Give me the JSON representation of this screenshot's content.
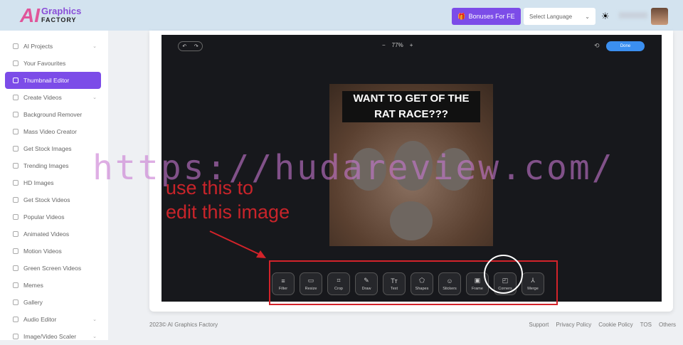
{
  "header": {
    "logo_ai": "AI",
    "logo_graphics": "Graphics",
    "logo_factory": "FACTORY",
    "bonus_label": "Bonuses For FE",
    "language_placeholder": "Select Language"
  },
  "sidebar": {
    "items": [
      {
        "label": "AI Projects",
        "chevron": true
      },
      {
        "label": "Your Favourites"
      },
      {
        "label": "Thumbnail Editor",
        "active": true
      },
      {
        "label": "Create Videos",
        "chevron": true
      },
      {
        "label": "Background Remover"
      },
      {
        "label": "Mass Video Creator"
      },
      {
        "label": "Get Stock Images"
      },
      {
        "label": "Trending Images"
      },
      {
        "label": "HD Images"
      },
      {
        "label": "Get Stock Videos"
      },
      {
        "label": "Popular Videos"
      },
      {
        "label": "Animated Videos"
      },
      {
        "label": "Motion Videos"
      },
      {
        "label": "Green Screen Videos"
      },
      {
        "label": "Memes"
      },
      {
        "label": "Gallery"
      },
      {
        "label": "Audio Editor",
        "chevron": true
      },
      {
        "label": "Image/Video Scaler",
        "chevron": true
      }
    ]
  },
  "editor": {
    "zoom": "77%",
    "done_label": "Done",
    "image_caption": "WANT TO GET OF THE RAT RACE???",
    "tools": [
      {
        "label": "Filter",
        "icon": "≡"
      },
      {
        "label": "Resize",
        "icon": "▭"
      },
      {
        "label": "Crop",
        "icon": "⌗"
      },
      {
        "label": "Draw",
        "icon": "✎"
      },
      {
        "label": "Text",
        "icon": "Tт"
      },
      {
        "label": "Shapes",
        "icon": "⬠"
      },
      {
        "label": "Stickers",
        "icon": "☺"
      },
      {
        "label": "Frame",
        "icon": "▣"
      },
      {
        "label": "Corners",
        "icon": "◰"
      },
      {
        "label": "Merge",
        "icon": "⅄"
      }
    ]
  },
  "annotation": {
    "line1": "use this to",
    "line2": "edit this image",
    "color": "#d3232a"
  },
  "watermark": "https://hudareview.com/",
  "footer": {
    "copyright": "2023© AI Graphics Factory",
    "links": [
      "Support",
      "Privacy Policy",
      "Cookie Policy",
      "TOS",
      "Others"
    ]
  },
  "colors": {
    "accent": "#7c4ce8",
    "done": "#3b8ff0"
  }
}
